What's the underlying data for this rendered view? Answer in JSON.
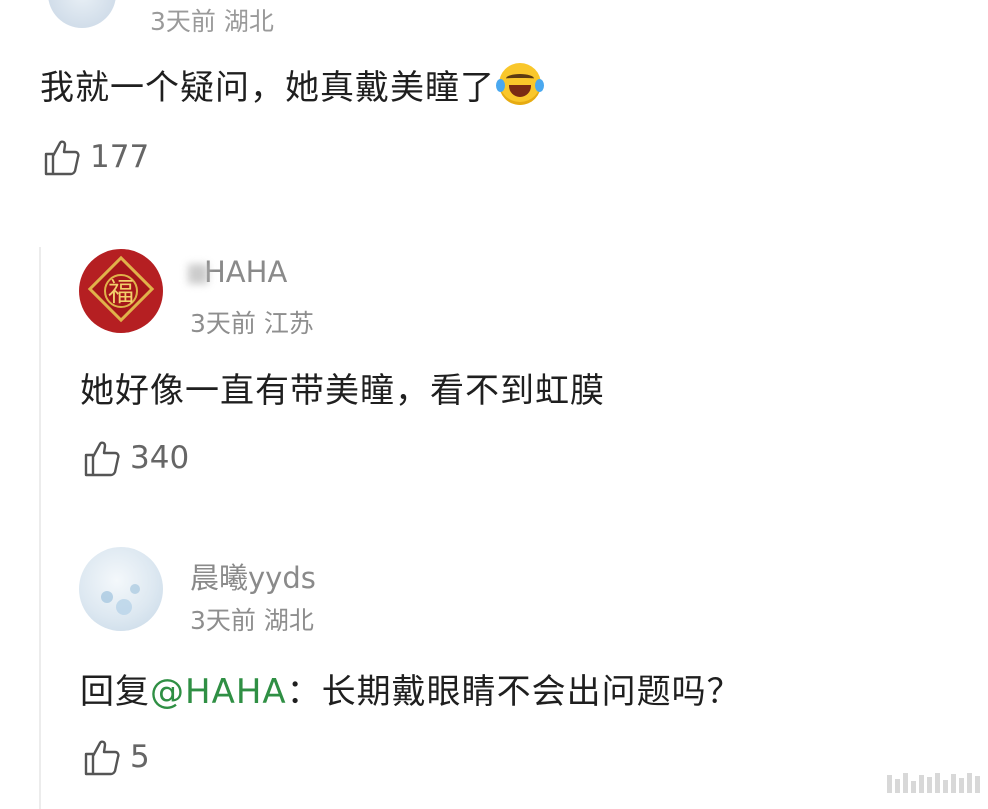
{
  "top_comment": {
    "meta": "3天前 湖北",
    "text": "我就一个疑问，她真戴美瞳了",
    "emoji": "laughing-tears-emoji",
    "likes": "177"
  },
  "reply1": {
    "username": "HAHA",
    "meta": "3天前 江苏",
    "text": "她好像一直有带美瞳，看不到虹膜",
    "likes": "340"
  },
  "reply2": {
    "username": "晨曦yyds",
    "meta": "3天前 湖北",
    "text_prefix": "回复",
    "mention": "@HAHA",
    "text_suffix": "：长期戴眼睛不会出问题吗？",
    "likes": "5"
  },
  "colors": {
    "text": "#1f1f1f",
    "meta": "#8e8e8e",
    "mention": "#2f8f44",
    "avatar1": "#b51f22"
  }
}
